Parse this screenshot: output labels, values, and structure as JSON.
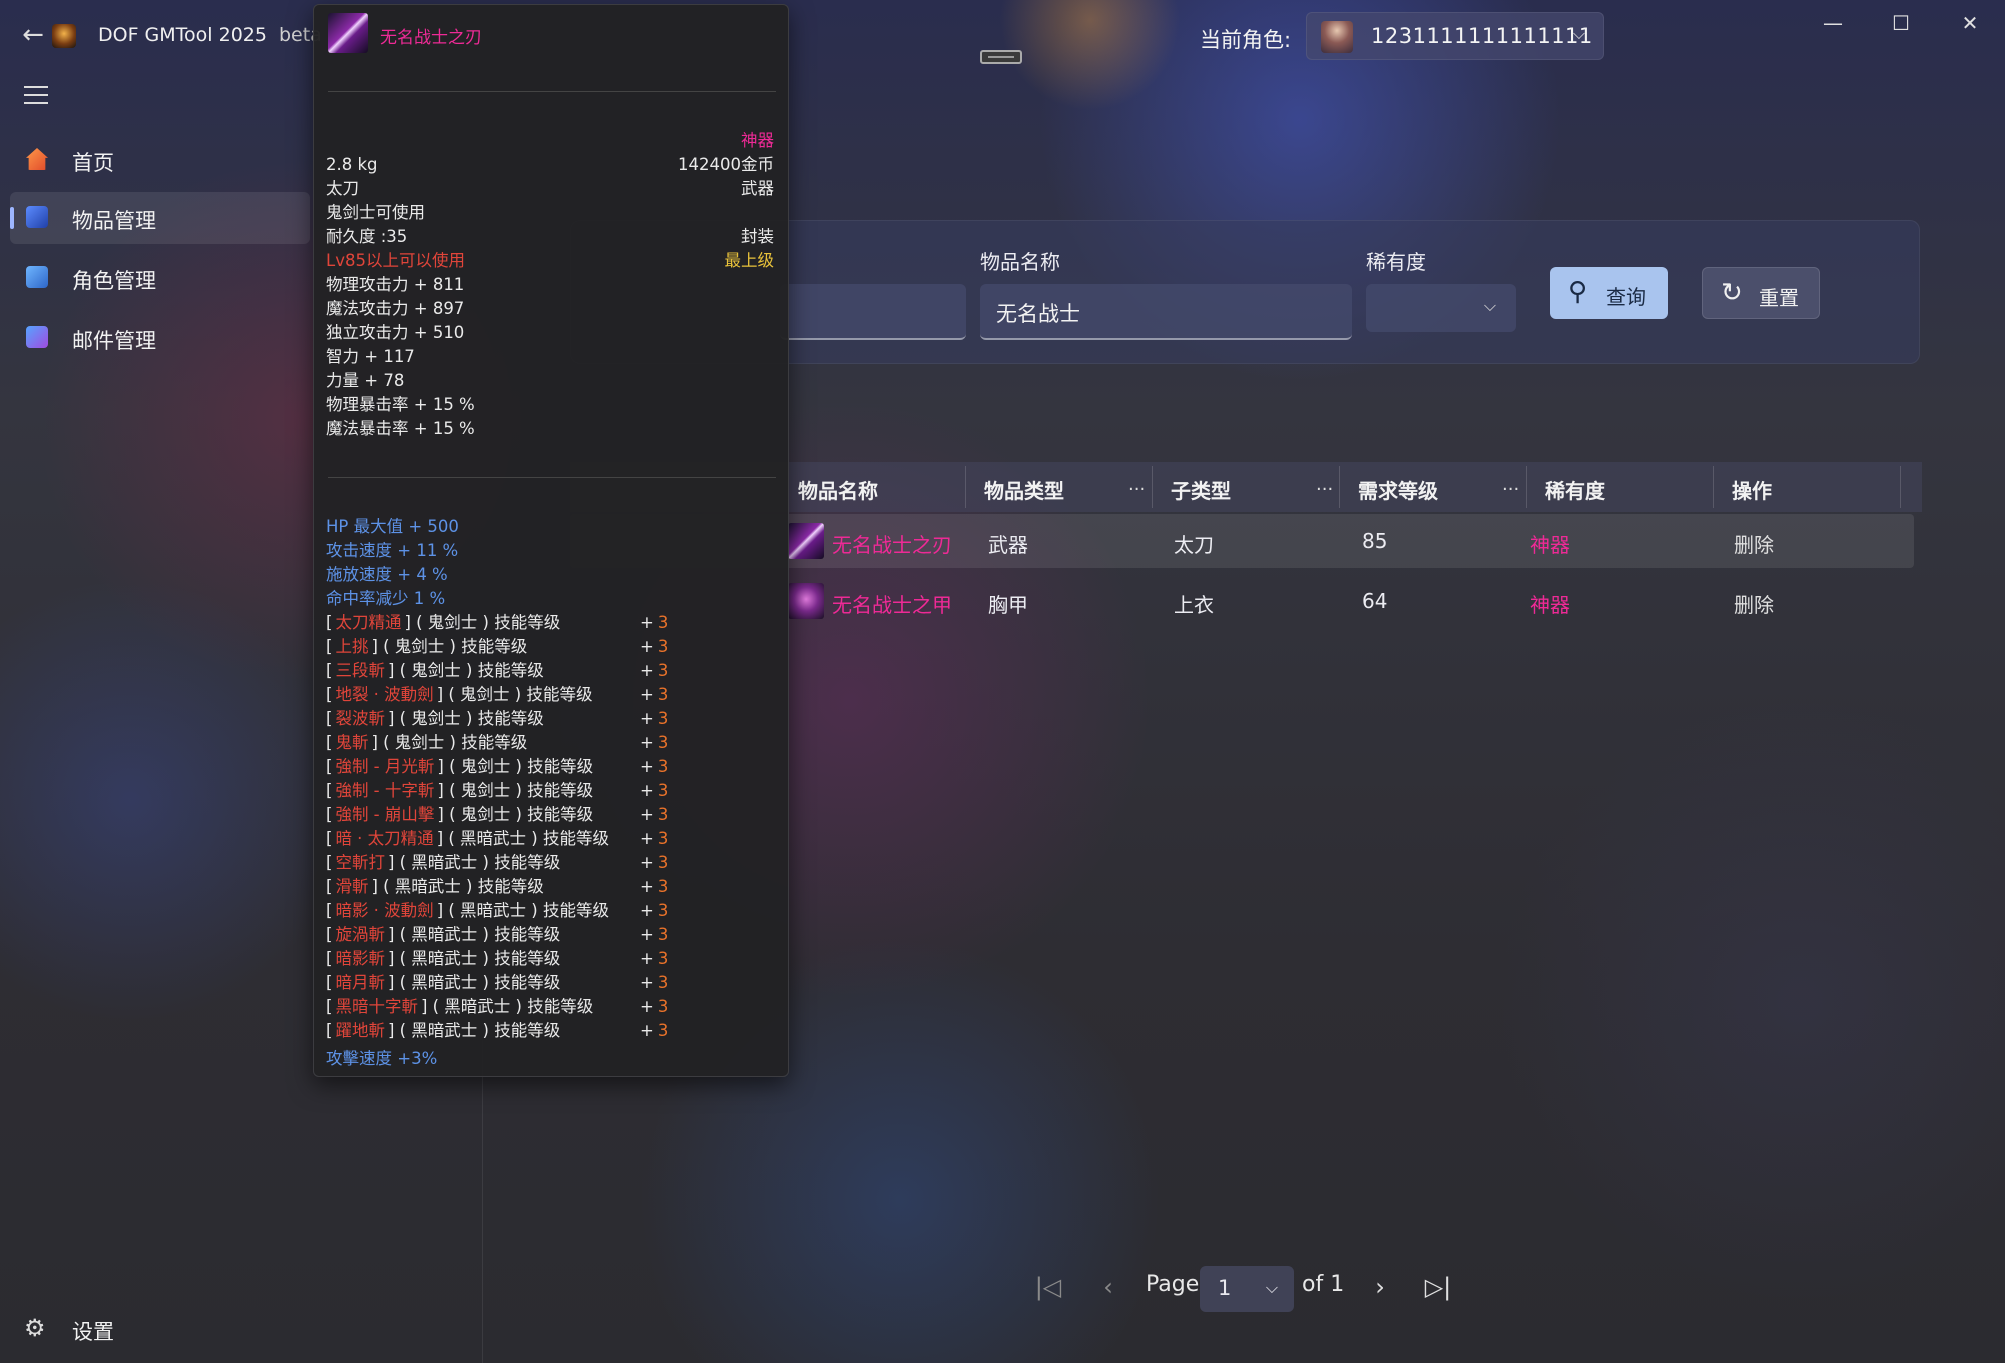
{
  "app": {
    "title": "DOF GMTool 2025",
    "badge": "beta"
  },
  "role": {
    "label": "当前角色:",
    "name": "1231111111111111"
  },
  "sidebar": {
    "items": [
      {
        "label": "首页",
        "icon": "home-icon"
      },
      {
        "label": "物品管理",
        "icon": "items-icon",
        "active": true
      },
      {
        "label": "角色管理",
        "icon": "roles-icon"
      },
      {
        "label": "邮件管理",
        "icon": "mail-icon"
      }
    ],
    "settings_label": "设置"
  },
  "filters": {
    "name_label": "物品名称",
    "name_value": "无名战士",
    "rarity_label": "稀有度",
    "rarity_value": "",
    "query_label": "查询",
    "reset_label": "重置"
  },
  "table": {
    "columns": [
      "物品名称",
      "物品类型",
      "子类型",
      "需求等级",
      "稀有度",
      "操作"
    ],
    "more": "...",
    "rows": [
      {
        "name": "无名战士之刃",
        "type": "武器",
        "subtype": "太刀",
        "level": "85",
        "rarity": "神器",
        "action": "删除"
      },
      {
        "name": "无名战士之甲",
        "type": "胸甲",
        "subtype": "上衣",
        "level": "64",
        "rarity": "神器",
        "action": "删除"
      }
    ]
  },
  "pagination": {
    "page_label": "Page",
    "current": "1",
    "of_label": "of 1"
  },
  "tooltip": {
    "title": "无名战士之刃",
    "rarity": "神器",
    "weight": "2.8 kg",
    "price": "142400金币",
    "subtype": "太刀",
    "category": "武器",
    "usable": "鬼剑士可使用",
    "durability": "耐久度 :35",
    "sealed": "封装",
    "level_req": "Lv85以上可以使用",
    "grade": "最上级",
    "stats": [
      "物理攻击力 + 811",
      "魔法攻击力 + 897",
      "独立攻击力 + 510",
      "智力 + 117",
      "力量 + 78",
      "物理暴击率 + 15 %",
      "魔法暴击率 + 15 %"
    ],
    "bonus": [
      "HP 最大值 + 500",
      "攻击速度 + 11 %",
      "施放速度 + 4 %",
      "命中率减少 1 %"
    ],
    "skill_open": "[",
    "skill_close": "]",
    "skill_plus": "+",
    "skills": [
      {
        "name": "太刀精通",
        "desc": "( 鬼剑士 ) 技能等级",
        "value": "3"
      },
      {
        "name": "上挑",
        "desc": "( 鬼剑士 ) 技能等级",
        "value": "3"
      },
      {
        "name": "三段斬",
        "desc": "( 鬼剑士 ) 技能等级",
        "value": "3"
      },
      {
        "name": "地裂 · 波動劍",
        "desc": "( 鬼剑士 ) 技能等级",
        "value": "3"
      },
      {
        "name": "裂波斬",
        "desc": "( 鬼剑士 ) 技能等级",
        "value": "3"
      },
      {
        "name": "鬼斬",
        "desc": "( 鬼剑士 ) 技能等级",
        "value": "3"
      },
      {
        "name": "強制 - 月光斬",
        "desc": "( 鬼剑士 ) 技能等级",
        "value": "3"
      },
      {
        "name": "強制 - 十字斬",
        "desc": "( 鬼剑士 ) 技能等级",
        "value": "3"
      },
      {
        "name": "強制 - 崩山擊",
        "desc": "( 鬼剑士 ) 技能等级",
        "value": "3"
      },
      {
        "name": "暗 · 太刀精通",
        "desc": "( 黑暗武士 ) 技能等级",
        "value": "3"
      },
      {
        "name": "空斬打",
        "desc": "( 黑暗武士 ) 技能等级",
        "value": "3"
      },
      {
        "name": "滑斬",
        "desc": "( 黑暗武士 ) 技能等级",
        "value": "3"
      },
      {
        "name": "暗影 · 波動劍",
        "desc": "( 黑暗武士 ) 技能等级",
        "value": "3"
      },
      {
        "name": "旋渦斬",
        "desc": "( 黑暗武士 ) 技能等级",
        "value": "3"
      },
      {
        "name": "暗影斬",
        "desc": "( 黑暗武士 ) 技能等级",
        "value": "3"
      },
      {
        "name": "暗月斬",
        "desc": "( 黑暗武士 ) 技能等级",
        "value": "3"
      },
      {
        "name": "黑暗十字斬",
        "desc": "( 黑暗武士 ) 技能等级",
        "value": "3"
      },
      {
        "name": "躍地斬",
        "desc": "( 黑暗武士 ) 技能等级",
        "value": "3"
      }
    ],
    "footer": "攻擊速度 +3%"
  },
  "colors": {
    "rarity_epic": "#ee2a96",
    "accent": "#a9c4ee",
    "skill_name": "#e0453a",
    "skill_value": "#e8722a",
    "bonus": "#5d92e6",
    "grade": "#e8c23a"
  }
}
